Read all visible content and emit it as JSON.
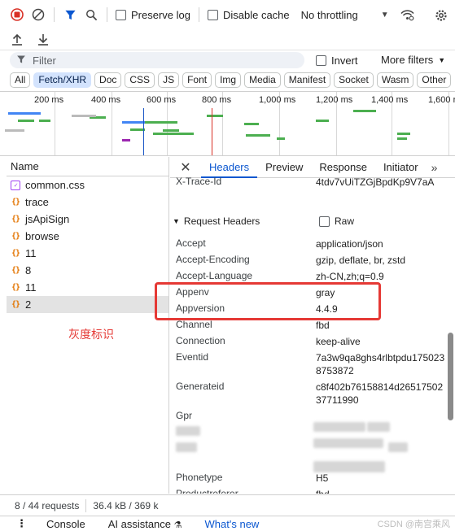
{
  "toolbar": {
    "preserve_log": "Preserve log",
    "disable_cache": "Disable cache",
    "throttling": "No throttling"
  },
  "filter": {
    "placeholder": "Filter",
    "invert": "Invert",
    "more_filters": "More filters"
  },
  "type_filters": [
    "All",
    "Fetch/XHR",
    "Doc",
    "CSS",
    "JS",
    "Font",
    "Img",
    "Media",
    "Manifest",
    "Socket",
    "Wasm",
    "Other"
  ],
  "selected_type": "Fetch/XHR",
  "overview_ticks": [
    "200 ms",
    "400 ms",
    "600 ms",
    "800 ms",
    "1,000 ms",
    "1,200 ms",
    "1,400 ms",
    "1,600 r"
  ],
  "requests": {
    "header": "Name",
    "items": [
      {
        "name": "common.css",
        "type": "css"
      },
      {
        "name": "trace",
        "type": "xhr"
      },
      {
        "name": "jsApiSign",
        "type": "xhr"
      },
      {
        "name": "browse",
        "type": "xhr"
      },
      {
        "name": "11",
        "type": "xhr"
      },
      {
        "name": "8",
        "type": "xhr"
      },
      {
        "name": "11",
        "type": "xhr"
      },
      {
        "name": "2",
        "type": "xhr",
        "selected": true
      }
    ]
  },
  "annotation": "灰度标识",
  "detail": {
    "tabs": [
      "Headers",
      "Preview",
      "Response",
      "Initiator"
    ],
    "active_tab": "Headers",
    "top_header": {
      "key": "X-Trace-Id",
      "value": "4tdv7vUiTZGjBpdKp9V7aA"
    },
    "section_title": "Request Headers",
    "raw_label": "Raw",
    "headers": [
      {
        "key": "Accept",
        "value": "application/json"
      },
      {
        "key": "Accept-Encoding",
        "value": "gzip, deflate, br, zstd"
      },
      {
        "key": "Accept-Language",
        "value": "zh-CN,zh;q=0.9"
      },
      {
        "key": "Appenv",
        "value": "gray"
      },
      {
        "key": "Appversion",
        "value": "4.4.9"
      },
      {
        "key": "Channel",
        "value": "fbd"
      },
      {
        "key": "Connection",
        "value": "keep-alive"
      },
      {
        "key": "Eventid",
        "value": "7a3w9qa8ghs4rlbtpdu1750238753872"
      },
      {
        "key": "Generateid",
        "value": "c8f402b76158814d2651750237711990"
      },
      {
        "key": "Gpr",
        "value": ""
      },
      {
        "key": "Phonetype",
        "value": "H5"
      },
      {
        "key": "Productreferer",
        "value": "fbd"
      },
      {
        "key": "Realip",
        "value": ""
      }
    ]
  },
  "status": {
    "requests": "8 / 44 requests",
    "transferred": "36.4 kB / 369 k"
  },
  "drawer": {
    "tabs": [
      "Console",
      "AI assistance",
      "What's new"
    ],
    "active": "What's new"
  },
  "watermark": "CSDN @南宫乘风",
  "colors": {
    "accent": "#0b57d0",
    "record_red": "#d93025",
    "annotation_red": "#e53935",
    "xhr_icon": "#e37400"
  }
}
